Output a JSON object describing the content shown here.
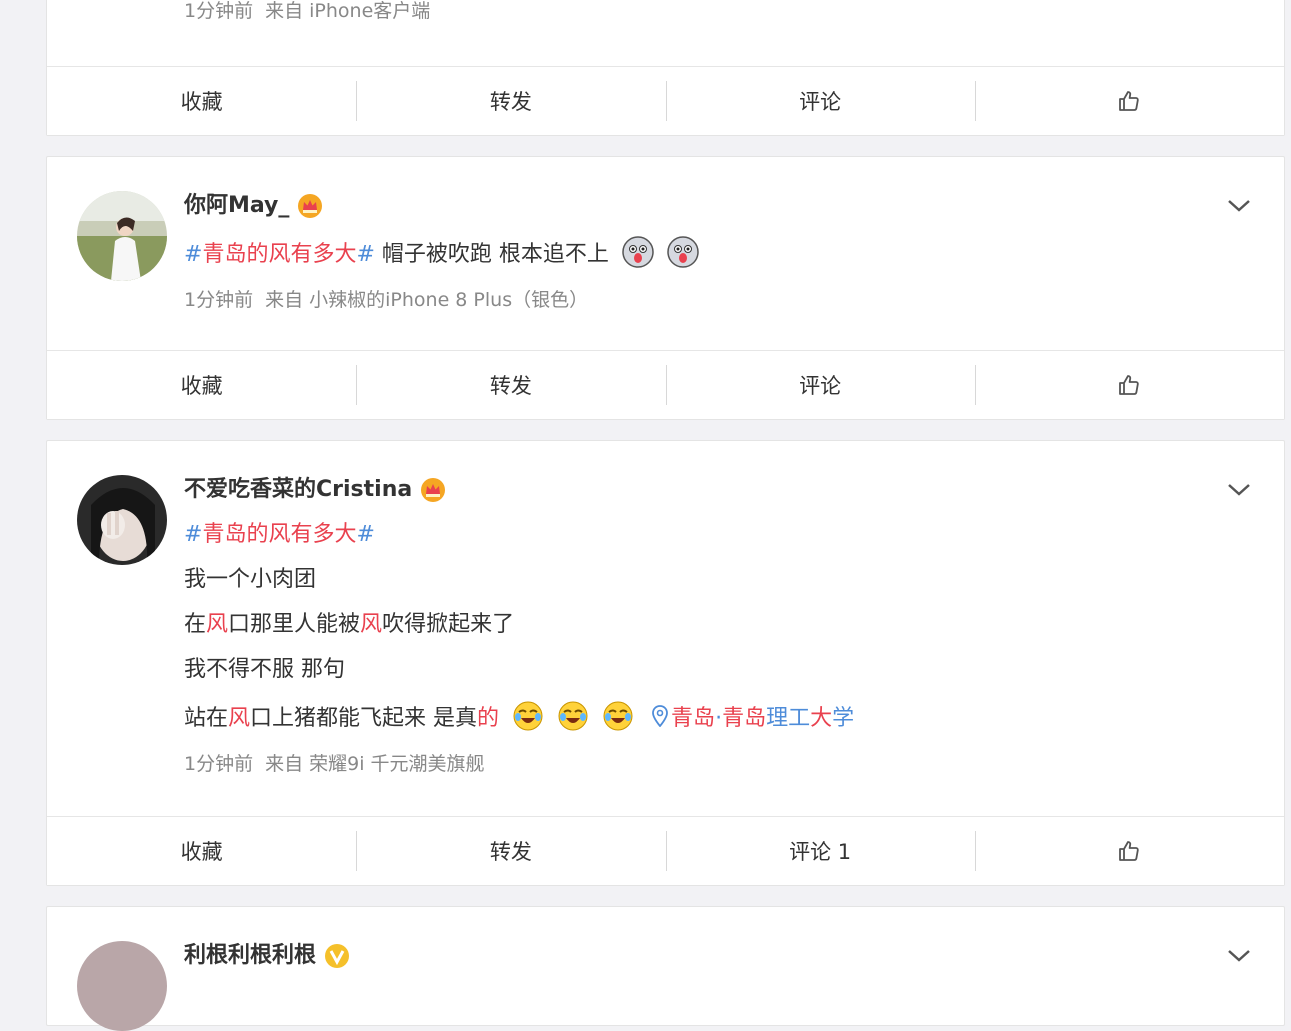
{
  "posts": [
    {
      "meta_time": "1分钟前",
      "meta_from": "来自 iPhone客户端",
      "actions": {
        "favorite": "收藏",
        "repost": "转发",
        "comment": "评论"
      }
    },
    {
      "username": "你阿May_",
      "hashtag": "#青岛的风有多大#",
      "hashtag_inner": "青岛的风有多大",
      "text": " 帽子被吹跑 根本追不上",
      "meta_time": "1分钟前",
      "meta_from": "来自 小辣椒的iPhone 8 Plus（银色）",
      "actions": {
        "favorite": "收藏",
        "repost": "转发",
        "comment": "评论"
      }
    },
    {
      "username": "不爱吃香菜的Cristina",
      "hashtag_inner": "青岛的风有多大",
      "lines": [
        "我一个小肉团",
        "那里人能被",
        "吹得掀起来了",
        "我不得不服 那句",
        "站在",
        "口上猪都能飞起来 是真"
      ],
      "line2_pre": "在",
      "line2_red1": "风",
      "line2_mid": "口那里人能被",
      "line2_red2": "风",
      "line2_post": "吹得掀起来了",
      "line4_pre": "站在",
      "line4_red": "风",
      "line4_mid": "口上猪都能飞起来 是真",
      "line4_red2": "的",
      "location_red1": "青岛",
      "location_dot": "·",
      "location_red2": "青岛",
      "location_blue1": "理工",
      "location_red3": "大",
      "location_blue2": "学",
      "meta_time": "1分钟前",
      "meta_from": "来自 荣耀9i 千元潮美旗舰",
      "actions": {
        "favorite": "收藏",
        "repost": "转发",
        "comment": "评论 1"
      }
    },
    {
      "username": "利根利根利根"
    }
  ],
  "colors": {
    "topic": "#e9414e",
    "hash": "#4e8cd9",
    "meta": "#888888"
  }
}
